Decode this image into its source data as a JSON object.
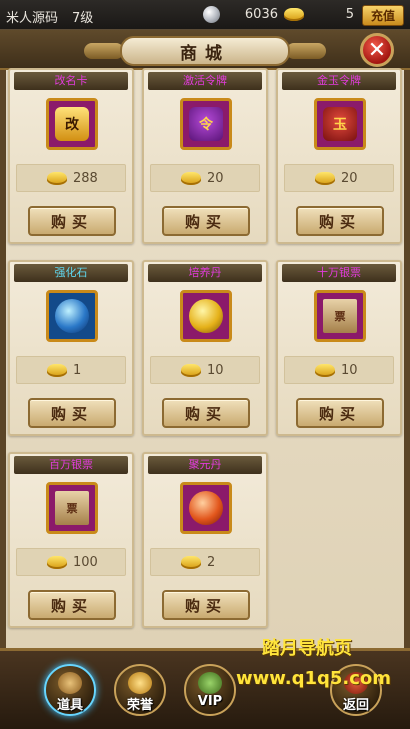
{
  "status_bar": {
    "player_name": "米人源码",
    "level": "7级",
    "silver_icon": "silver-coin-icon",
    "silver": "6036",
    "gold_icon": "gold-ingot-icon",
    "gold": "5",
    "recharge_label": "充值"
  },
  "header": {
    "title": "商城",
    "close_icon": "close-icon"
  },
  "items": [
    {
      "name": "改名卡",
      "price": "288",
      "buy_label": "购买",
      "icon": "rename-card-icon",
      "name_color": "#e23bdc"
    },
    {
      "name": "激活令牌",
      "price": "20",
      "buy_label": "购买",
      "icon": "activation-token-icon",
      "name_color": "#e23bdc"
    },
    {
      "name": "金玉令牌",
      "price": "20",
      "buy_label": "购买",
      "icon": "gold-jade-token-icon",
      "name_color": "#e23bdc"
    },
    {
      "name": "强化石",
      "price": "1",
      "buy_label": "购买",
      "icon": "enhance-stone-icon",
      "name_color": "#5fd8f0"
    },
    {
      "name": "培养丹",
      "price": "10",
      "buy_label": "购买",
      "icon": "cultivation-pill-icon",
      "name_color": "#e23bdc"
    },
    {
      "name": "十万银票",
      "price": "10",
      "buy_label": "购买",
      "icon": "banknote-icon",
      "name_color": "#e23bdc"
    },
    {
      "name": "百万银票",
      "price": "100",
      "buy_label": "购买",
      "icon": "banknote-icon",
      "name_color": "#e23bdc"
    },
    {
      "name": "聚元丹",
      "price": "2",
      "buy_label": "购买",
      "icon": "elixir-icon",
      "name_color": "#e23bdc"
    }
  ],
  "bottom_nav": {
    "props_label": "道具",
    "honor_label": "荣誉",
    "vip_label": "VIP",
    "back_label": "返回"
  },
  "watermark": {
    "line1": "踏月导航页",
    "line2": "www.q1q5.com"
  }
}
